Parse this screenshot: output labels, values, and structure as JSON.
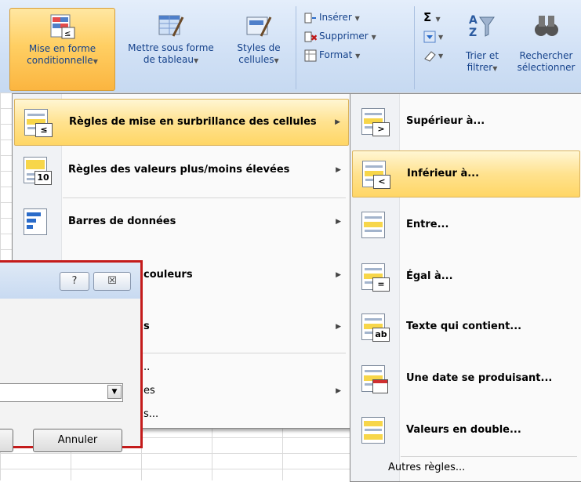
{
  "ribbon": {
    "mise_en_forme": {
      "line1": "Mise en forme",
      "line2": "conditionnelle"
    },
    "mettre_sous_forme": {
      "line1": "Mettre sous forme",
      "line2": "de tableau"
    },
    "styles": {
      "line1": "Styles de",
      "line2": "cellules"
    },
    "inserer": "Insérer",
    "supprimer": "Supprimer",
    "format": "Format",
    "sigma": "Σ",
    "trier": {
      "line1": "Trier et",
      "line2": "filtrer"
    },
    "rechercher": {
      "line1": "Rechercher",
      "line2": "sélectionner"
    }
  },
  "main_menu": {
    "items": [
      {
        "label": "Règles de mise en surbrillance des cellules",
        "icon": "highlight-rules-icon"
      },
      {
        "label": "Règles des valeurs plus/moins élevées",
        "icon": "top-bottom-rules-icon"
      },
      {
        "label": "Barres de données",
        "icon": "data-bars-icon"
      },
      {
        "label": "couleurs",
        "icon": "color-scales-icon"
      },
      {
        "label": "s",
        "icon": "icon-sets-icon"
      }
    ],
    "lower_items": [
      "..",
      "es",
      "s..."
    ]
  },
  "submenu": {
    "items": [
      {
        "label": "Supérieur à...",
        "badge": ">"
      },
      {
        "label": "Inférieur à...",
        "badge": "<"
      },
      {
        "label": "Entre...",
        "badge": ""
      },
      {
        "label": "Égal à...",
        "badge": "="
      },
      {
        "label": "Texte qui contient...",
        "badge": "ab"
      },
      {
        "label": "Une date se produisant...",
        "badge": ""
      },
      {
        "label": "Valeurs en double...",
        "badge": ""
      }
    ],
    "more_rules": "Autres règles..."
  },
  "dialog": {
    "help": "?",
    "close": "☒",
    "cancel": "Annuler"
  },
  "colors": {
    "accent": "#ffd665",
    "dialog_border": "#c41b1b"
  }
}
